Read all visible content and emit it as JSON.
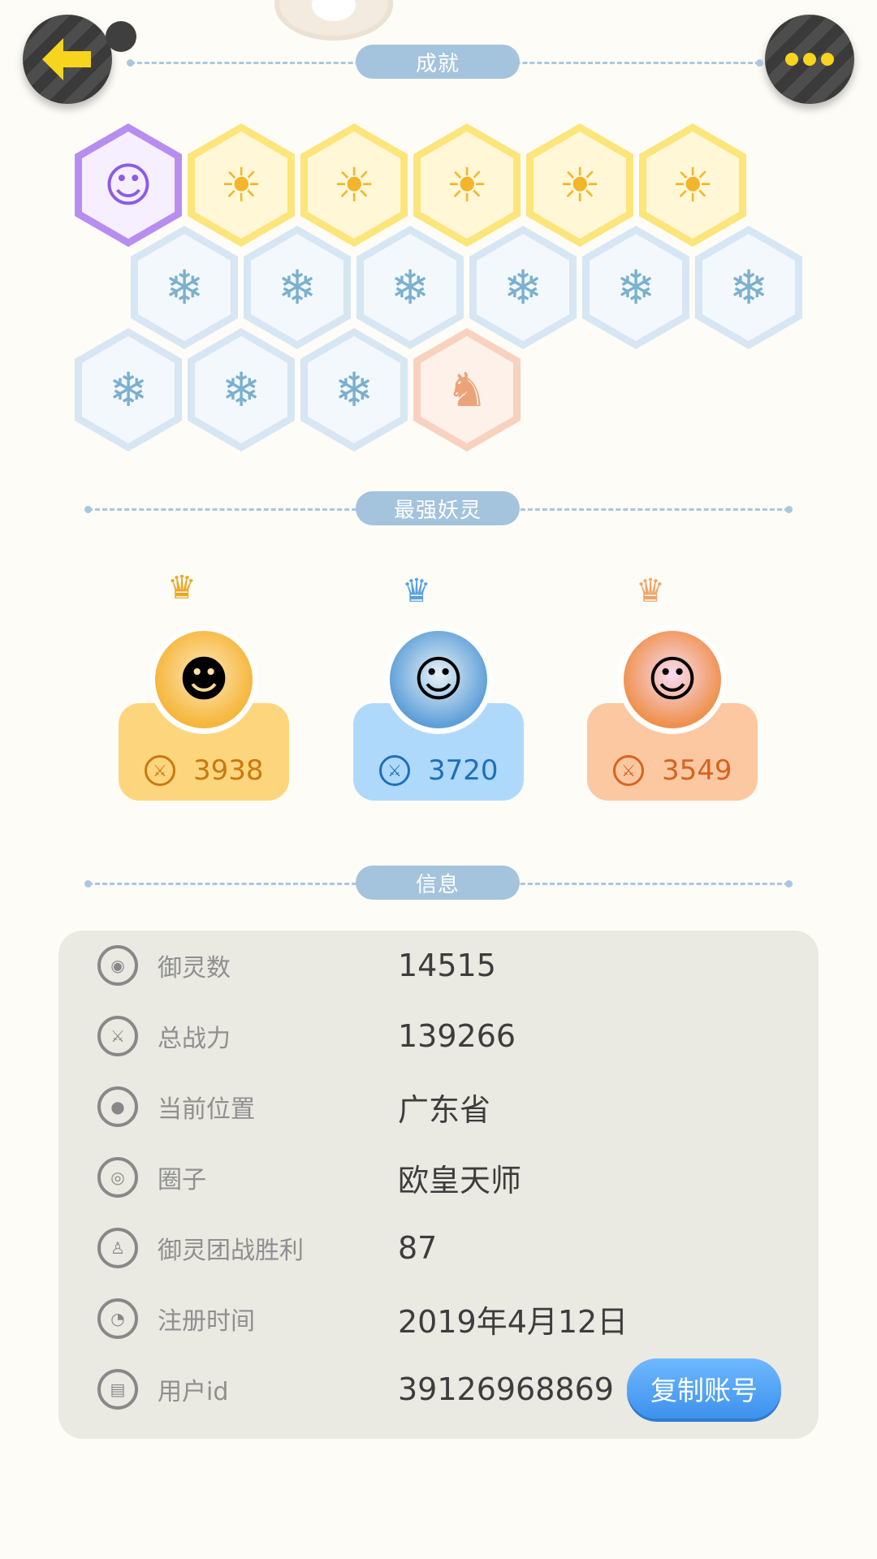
{
  "sections": {
    "achievements": "成就",
    "strongest": "最强妖灵",
    "info": "信息"
  },
  "colors": {
    "background": "#fdfcf6",
    "section_pill": "#a4c3dd",
    "gold_card": "#fdd57c",
    "blue_card": "#aed9fb",
    "peach_card": "#fcc8a2",
    "copy_button": "#3d92ec",
    "back_arrow": "#f7d41d"
  },
  "header": {
    "back_icon": "back-arrow-icon",
    "more_icon": "more-dots-icon"
  },
  "achievements": [
    {
      "icon": "purple-cat-badge",
      "tier": "purple"
    },
    {
      "icon": "sun-medal-badge",
      "tier": "gold"
    },
    {
      "icon": "golden-orb-badge",
      "tier": "gold"
    },
    {
      "icon": "yinyang-comet-badge",
      "tier": "gold"
    },
    {
      "icon": "yinyang-cube-badge",
      "tier": "gold"
    },
    {
      "icon": "fox-book-badge",
      "tier": "gold"
    },
    {
      "icon": "sneaker-badge",
      "tier": "blue"
    },
    {
      "icon": "moon-badge",
      "tier": "blue"
    },
    {
      "icon": "crystal-badge",
      "tier": "blue"
    },
    {
      "icon": "spirit-figure-badge",
      "tier": "blue"
    },
    {
      "icon": "stroller-badge",
      "tier": "blue"
    },
    {
      "icon": "cat-balloon-badge",
      "tier": "blue"
    },
    {
      "icon": "koi-fish-badge",
      "tier": "blue"
    },
    {
      "icon": "shield-badge",
      "tier": "blue"
    },
    {
      "icon": "bear-badge",
      "tier": "blue"
    },
    {
      "icon": "horned-statue-badge",
      "tier": "peach"
    }
  ],
  "strongest_spirits": [
    {
      "power": "3938",
      "tier": "gold",
      "crown": "gold-crown-icon"
    },
    {
      "power": "3720",
      "tier": "blue",
      "crown": "blue-crown-icon"
    },
    {
      "power": "3549",
      "tier": "peach",
      "crown": "orange-crown-icon"
    }
  ],
  "info": {
    "rows": [
      {
        "label": "御灵数",
        "value": "14515",
        "icon": "spirit-count-icon"
      },
      {
        "label": "总战力",
        "value": "139266",
        "icon": "sword-power-icon"
      },
      {
        "label": "当前位置",
        "value": "广东省",
        "icon": "location-pin-icon"
      },
      {
        "label": "圈子",
        "value": "欧皇天师",
        "icon": "circle-target-icon"
      },
      {
        "label": "御灵团战胜利",
        "value": "87",
        "icon": "team-battle-icon"
      },
      {
        "label": "注册时间",
        "value": "2019年4月12日",
        "icon": "clock-icon"
      },
      {
        "label": "用户id",
        "value": "39126968869",
        "icon": "user-id-icon"
      }
    ],
    "copy_button": "复制账号"
  }
}
